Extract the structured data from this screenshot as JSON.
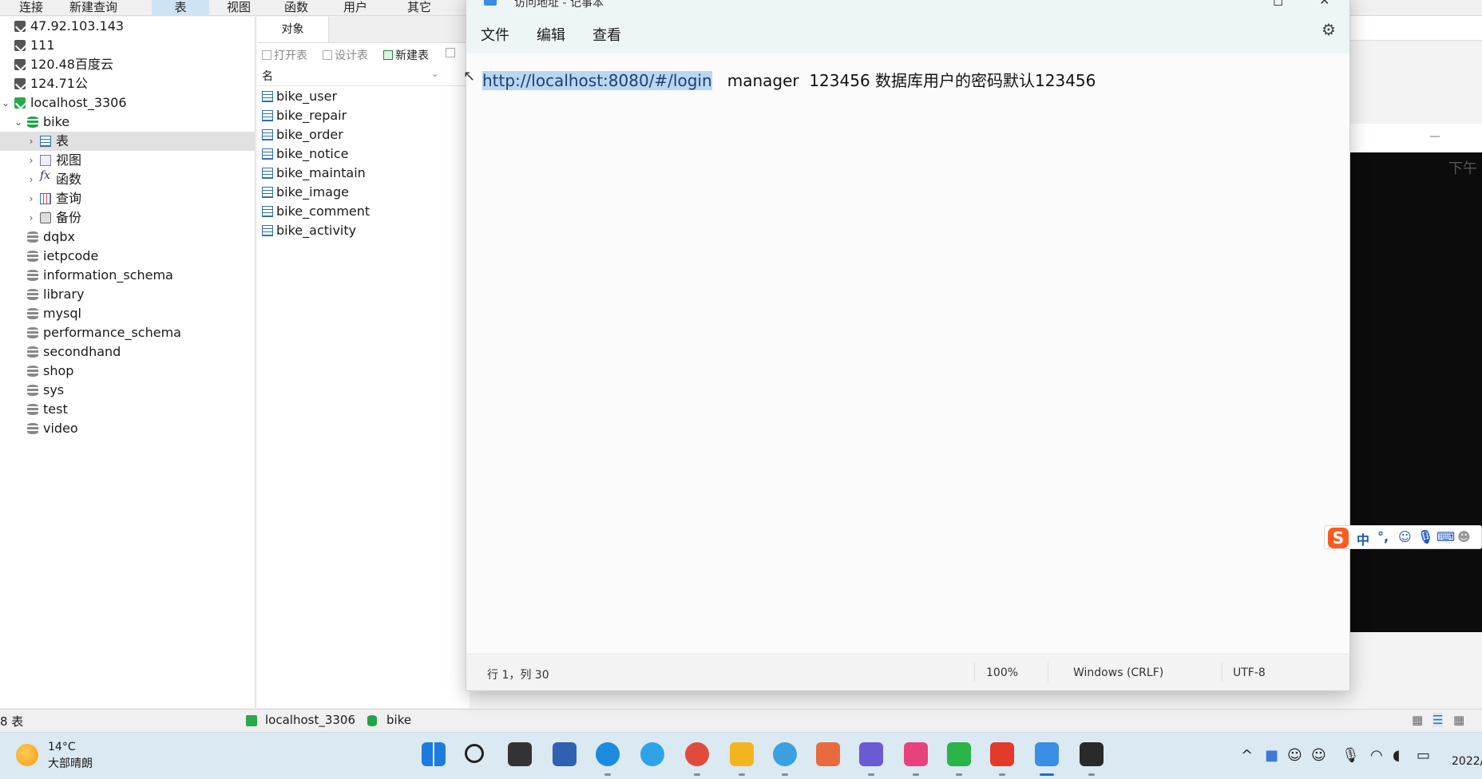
{
  "navicat": {
    "menu": [
      {
        "label": "连接",
        "active": false
      },
      {
        "label": "新建查询",
        "active": false
      },
      {
        "label": "表",
        "active": true
      },
      {
        "label": "视图",
        "active": false
      },
      {
        "label": "函数",
        "active": false
      },
      {
        "label": "用户",
        "active": false
      },
      {
        "label": "其它",
        "active": false
      }
    ],
    "tree": [
      {
        "label": "47.92.103.143",
        "icon": "connection-icon"
      },
      {
        "label": "111",
        "icon": "connection-icon"
      },
      {
        "label": "120.48百度云",
        "icon": "connection-icon"
      },
      {
        "label": "124.71公",
        "icon": "connection-icon"
      },
      {
        "label": "localhost_3306",
        "icon": "connection-icon",
        "expanded": true
      },
      {
        "label": "bike",
        "icon": "database-icon",
        "expanded": true
      },
      {
        "label": "表",
        "icon": "table-icon",
        "selected": true
      },
      {
        "label": "视图",
        "icon": "view-icon"
      },
      {
        "label": "函数",
        "icon": "function-icon"
      },
      {
        "label": "查询",
        "icon": "query-icon"
      },
      {
        "label": "备份",
        "icon": "backup-icon"
      },
      {
        "label": "dqbx",
        "icon": "database-icon"
      },
      {
        "label": "ietpcode",
        "icon": "database-icon"
      },
      {
        "label": "information_schema",
        "icon": "database-icon"
      },
      {
        "label": "library",
        "icon": "database-icon"
      },
      {
        "label": "mysql",
        "icon": "database-icon"
      },
      {
        "label": "performance_schema",
        "icon": "database-icon"
      },
      {
        "label": "secondhand",
        "icon": "database-icon"
      },
      {
        "label": "shop",
        "icon": "database-icon"
      },
      {
        "label": "sys",
        "icon": "database-icon"
      },
      {
        "label": "test",
        "icon": "database-icon"
      },
      {
        "label": "video",
        "icon": "database-icon"
      }
    ],
    "objects_tab": "对象",
    "toolbar": {
      "open": "打开表",
      "design": "设计表",
      "new": "新建表"
    },
    "column_header": "名",
    "tables": [
      "bike_user",
      "bike_repair",
      "bike_order",
      "bike_notice",
      "bike_maintain",
      "bike_image",
      "bike_comment",
      "bike_activity"
    ],
    "status": {
      "count": "8 表",
      "connection": "localhost_3306",
      "database": "bike"
    }
  },
  "notepad": {
    "title": "访问地址 - 记事本",
    "menu": [
      "文件",
      "编辑",
      "查看"
    ],
    "content": {
      "selected": "http://localhost:8080/#/login",
      "rest": "   manager  123456 数据库用户的密码默认123456"
    },
    "status": {
      "position": "行 1，列 30",
      "zoom": "100%",
      "line_ending": "Windows (CRLF)",
      "encoding": "UTF-8"
    }
  },
  "console": {
    "text": "下午"
  },
  "ime": {
    "labels": [
      "中",
      "°,"
    ]
  },
  "taskbar": {
    "weather_temp": "14°C",
    "weather_condition": "大部晴朗",
    "apps": [
      {
        "name": "start-icon",
        "color": "#1e7be0"
      },
      {
        "name": "search-icon",
        "color": "#222222"
      },
      {
        "name": "task-view-icon",
        "color": "#333333"
      },
      {
        "name": "network-app-icon",
        "color": "#3060b0"
      },
      {
        "name": "edge-icon",
        "color": "#1b8be0"
      },
      {
        "name": "ie-icon",
        "color": "#2fa3e8"
      },
      {
        "name": "chrome-icon",
        "color": "#e24a3b"
      },
      {
        "name": "file-explorer-icon",
        "color": "#f2b51f"
      },
      {
        "name": "circle-app-icon",
        "color": "#3aa0e0"
      },
      {
        "name": "powerpoint-icon",
        "color": "#e96a3f"
      },
      {
        "name": "mountain-app-icon",
        "color": "#6b5bd2"
      },
      {
        "name": "jetbrains-icon",
        "color": "#e8427c"
      },
      {
        "name": "hbuilder-icon",
        "color": "#2bb44a"
      },
      {
        "name": "wps-icon",
        "color": "#e33a2c"
      },
      {
        "name": "notepad-icon",
        "color": "#3a8ee6"
      },
      {
        "name": "terminal-icon",
        "color": "#2a2a2a"
      }
    ],
    "clock": "2022/"
  }
}
